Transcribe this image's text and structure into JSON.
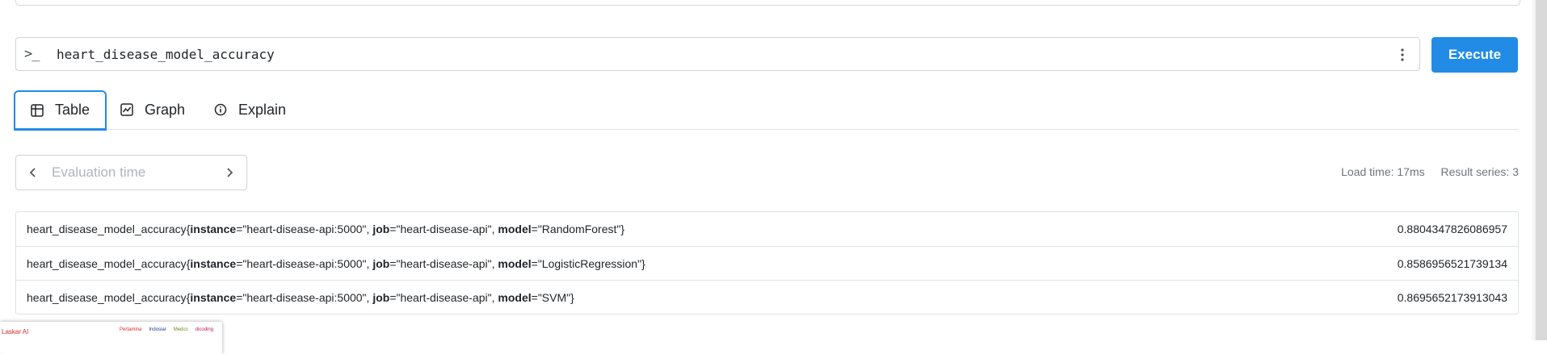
{
  "query": {
    "value": "heart_disease_model_accuracy",
    "prompt_icon": ">_",
    "execute_label": "Execute"
  },
  "tabs": [
    {
      "label": "Table",
      "icon": "table-icon",
      "active": true
    },
    {
      "label": "Graph",
      "icon": "graph-icon",
      "active": false
    },
    {
      "label": "Explain",
      "icon": "info-icon",
      "active": false
    }
  ],
  "eval_time": {
    "placeholder": "Evaluation time"
  },
  "stats": {
    "load_time": "Load time: 17ms",
    "result_series": "Result series: 3"
  },
  "results": [
    {
      "metric": "heart_disease_model_accuracy",
      "labels": [
        {
          "key": "instance",
          "value": "\"heart-disease-api:5000\""
        },
        {
          "key": "job",
          "value": "\"heart-disease-api\""
        },
        {
          "key": "model",
          "value": "\"RandomForest\""
        }
      ],
      "value": "0.8804347826086957"
    },
    {
      "metric": "heart_disease_model_accuracy",
      "labels": [
        {
          "key": "instance",
          "value": "\"heart-disease-api:5000\""
        },
        {
          "key": "job",
          "value": "\"heart-disease-api\""
        },
        {
          "key": "model",
          "value": "\"LogisticRegression\""
        }
      ],
      "value": "0.8586956521739134"
    },
    {
      "metric": "heart_disease_model_accuracy",
      "labels": [
        {
          "key": "instance",
          "value": "\"heart-disease-api:5000\""
        },
        {
          "key": "job",
          "value": "\"heart-disease-api\""
        },
        {
          "key": "model",
          "value": "\"SVM\""
        }
      ],
      "value": "0.8695652173913043"
    }
  ],
  "popup": {
    "brand": "Laskar AI",
    "logos": [
      "Pertamina",
      "Indosiar",
      "Medco",
      "dicoding"
    ]
  },
  "colors": {
    "accent": "#228be6",
    "border": "#ced4da",
    "muted": "#6c757d"
  }
}
